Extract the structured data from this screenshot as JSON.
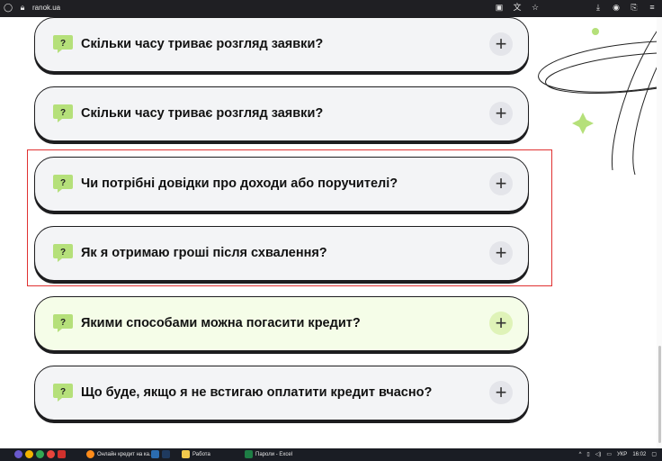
{
  "browser": {
    "url": "ranok.ua"
  },
  "faqs": [
    {
      "title": "Скільки часу триває розгляд заявки?"
    },
    {
      "title": "Скільки часу триває розгляд заявки?"
    },
    {
      "title": "Чи потрібні довідки про доходи або поручителі?"
    },
    {
      "title": "Як я отримаю гроші після схвалення?"
    },
    {
      "title": "Якими способами можна погасити кредит?"
    },
    {
      "title": "Що буде, якщо я не встигаю оплатити кредит вчасно?"
    }
  ],
  "faq_icon_glyph": "?",
  "faq_toggle_glyph": "+",
  "colors": {
    "accent_green": "#b5e07a",
    "active_card": "#f5fde8",
    "highlight_red": "#e03131"
  },
  "taskbar": {
    "tabs": [
      {
        "label": "Онлайн кредит на ка..."
      },
      {
        "label": "Работа"
      },
      {
        "label": "Пароли - Excel"
      }
    ],
    "language": "УКР",
    "time": "16:02"
  }
}
